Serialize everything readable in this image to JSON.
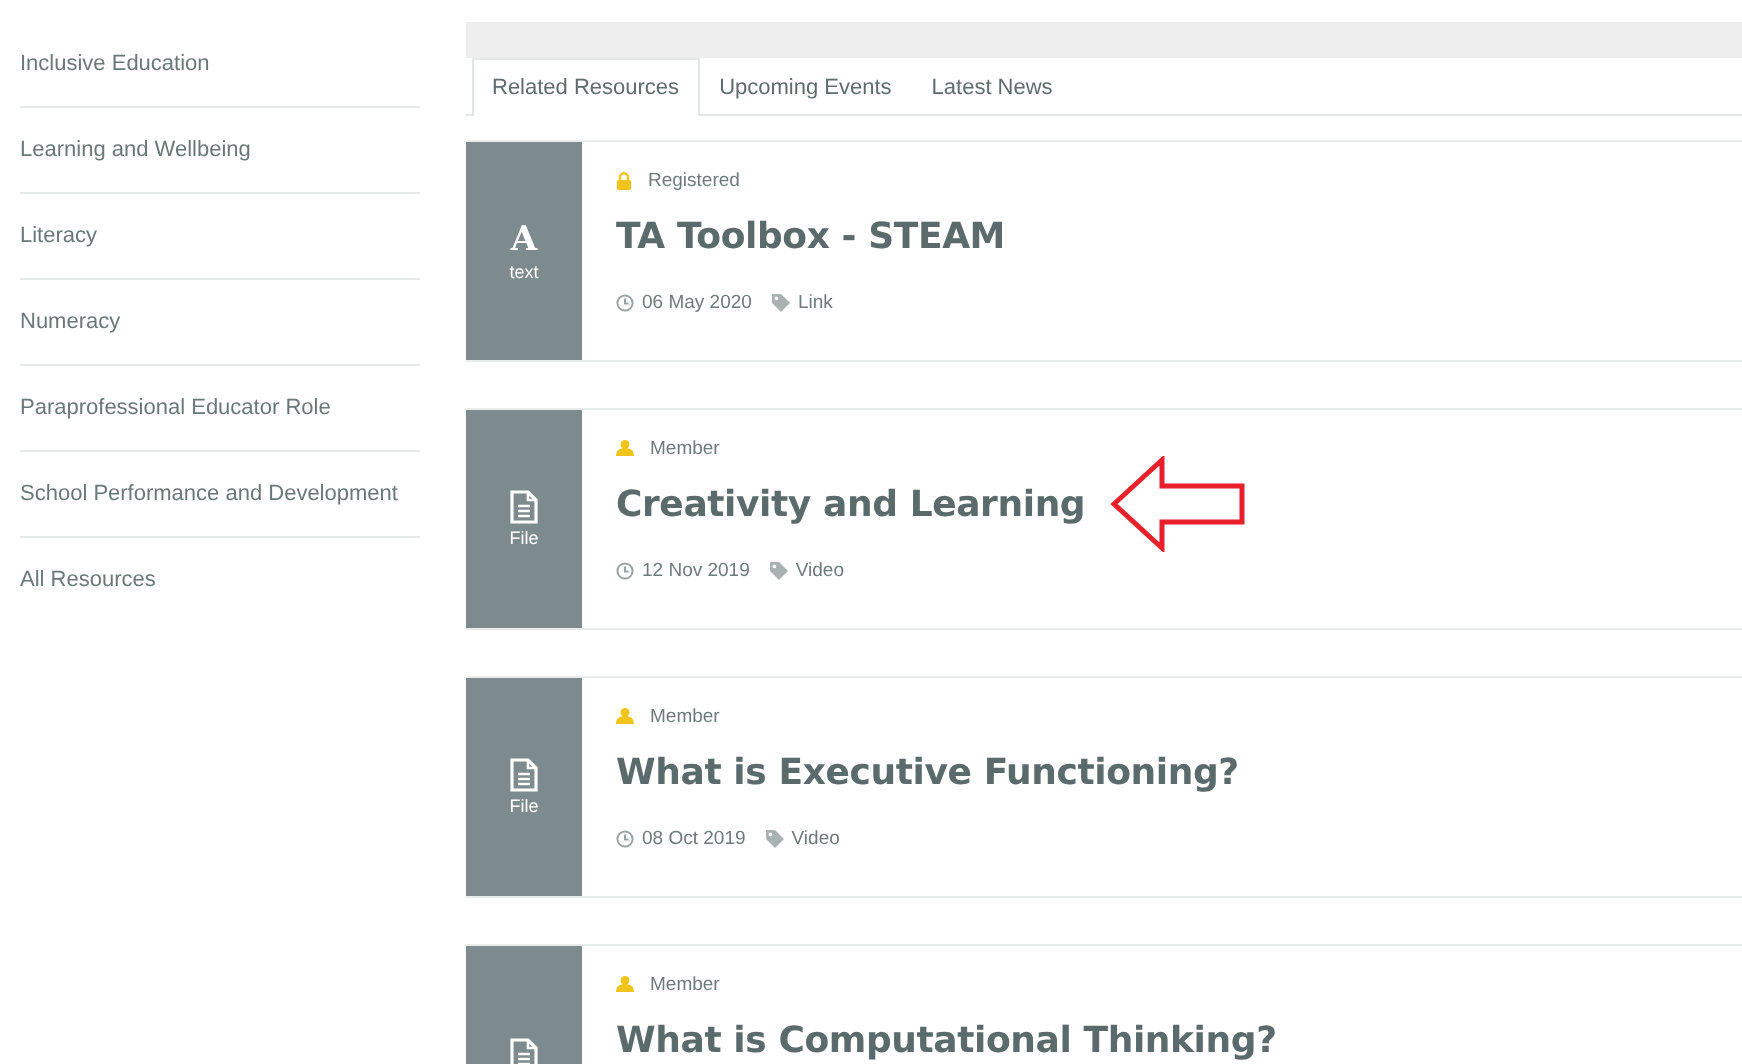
{
  "sidebar": {
    "items": [
      {
        "label": "Inclusive Education"
      },
      {
        "label": "Learning and Wellbeing"
      },
      {
        "label": "Literacy"
      },
      {
        "label": "Numeracy"
      },
      {
        "label": "Paraprofessional Educator Role"
      },
      {
        "label": "School Performance and Development"
      },
      {
        "label": "All Resources"
      }
    ]
  },
  "tabs": [
    {
      "label": "Related Resources",
      "selected": true
    },
    {
      "label": "Upcoming Events",
      "selected": false
    },
    {
      "label": "Latest News",
      "selected": false
    }
  ],
  "resources": [
    {
      "tile": {
        "kind": "glyph",
        "glyph": "A",
        "label": "text"
      },
      "access": {
        "kind": "lock",
        "label": "Registered"
      },
      "title": "TA Toolbox - STEAM",
      "date": "06 May 2020",
      "tag": "Link",
      "highlighted": false
    },
    {
      "tile": {
        "kind": "file",
        "label": "File"
      },
      "access": {
        "kind": "user",
        "label": "Member"
      },
      "title": "Creativity and Learning",
      "date": "12 Nov 2019",
      "tag": "Video",
      "highlighted": true
    },
    {
      "tile": {
        "kind": "file",
        "label": "File"
      },
      "access": {
        "kind": "user",
        "label": "Member"
      },
      "title": "What is Executive Functioning?",
      "date": "08 Oct 2019",
      "tag": "Video",
      "highlighted": false
    },
    {
      "tile": {
        "kind": "file"
      },
      "access": {
        "kind": "user",
        "label": "Member"
      },
      "title": "What is Computational Thinking?",
      "highlighted": false
    }
  ]
}
